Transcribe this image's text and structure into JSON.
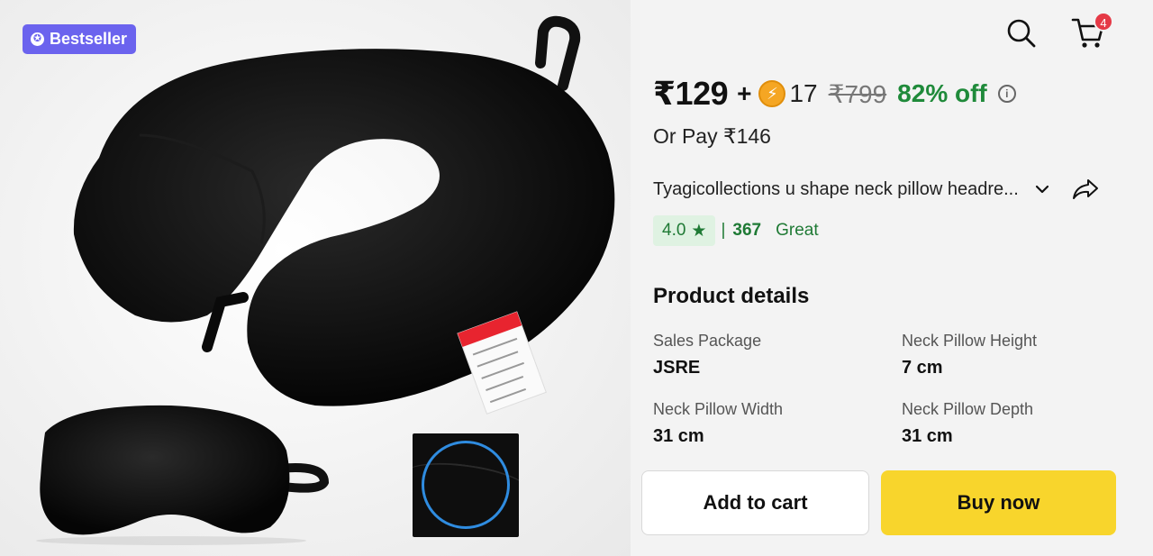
{
  "badge": {
    "label": "Bestseller",
    "icon": "star-badge-icon"
  },
  "header": {
    "search_icon": "search-icon",
    "cart_icon": "cart-icon",
    "cart_count": "4"
  },
  "price": {
    "current": "₹129",
    "plus": "+",
    "coins": "17",
    "coin_icon": "lightning-coin-icon",
    "mrp": "₹799",
    "discount": "82% off",
    "or_pay": "Or Pay ₹146"
  },
  "product": {
    "title": "Tyagicollections u shape neck pillow headre...",
    "rating": "4.0",
    "rating_star": "★",
    "rating_separator": "|",
    "rating_count": "367",
    "rating_word": "Great"
  },
  "details": {
    "heading": "Product details",
    "specs": [
      {
        "label": "Sales Package",
        "value": "JSRE"
      },
      {
        "label": "Neck Pillow Height",
        "value": "7 cm"
      },
      {
        "label": "Neck Pillow Width",
        "value": "31 cm"
      },
      {
        "label": "Neck Pillow Depth",
        "value": "31 cm"
      }
    ]
  },
  "actions": {
    "add_to_cart": "Add to cart",
    "buy_now": "Buy now"
  },
  "tag_text": [
    "100% Polyester",
    "Handwash only",
    "Do not bleach",
    "Do not iron",
    "Dry clean"
  ],
  "colors": {
    "accent_purple": "#6b63ee",
    "green": "#1f8a3a",
    "buy_yellow": "#f8d52c",
    "cart_badge": "#e53946"
  }
}
